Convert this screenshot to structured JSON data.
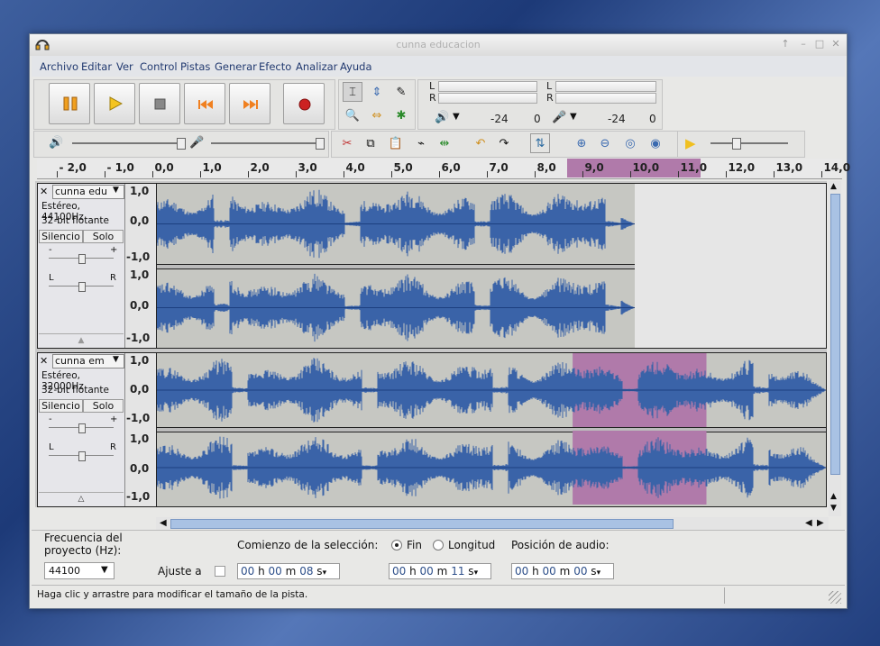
{
  "window": {
    "title": "cunna educacion"
  },
  "menu": [
    "Archivo",
    "Editar",
    "Ver",
    "Control",
    "Pistas",
    "Generar",
    "Efecto",
    "Analizar",
    "Ayuda"
  ],
  "meters": {
    "L": "L",
    "R": "R",
    "minus24a": "-24",
    "zero_a": "0",
    "minus24b": "-24",
    "zero_b": "0"
  },
  "ruler": [
    "- 2,0",
    "- 1,0",
    "0,0",
    "1,0",
    "2,0",
    "3,0",
    "4,0",
    "5,0",
    "6,0",
    "7,0",
    "8,0",
    "9,0",
    "10,0",
    "11,0",
    "12,0",
    "13,0",
    "14,0"
  ],
  "selection_range": {
    "start_seconds": 8.7,
    "end_seconds": 11.5
  },
  "tracks": [
    {
      "name": "cunna edu",
      "info1": "Estéreo, 44100Hz",
      "info2": "32-bit flotante",
      "mute": "Silencio",
      "solo": "Solo",
      "gain_minus": "-",
      "gain_plus": "+",
      "pan_l": "L",
      "pan_r": "R",
      "scale": [
        "1,0",
        "0,0",
        "-1,0"
      ],
      "length_seconds": 10.0
    },
    {
      "name": "cunna em",
      "info1": "Estéreo, 32000Hz",
      "info2": "32-bit flotante",
      "mute": "Silencio",
      "solo": "Solo",
      "gain_minus": "-",
      "gain_plus": "+",
      "pan_l": "L",
      "pan_r": "R",
      "scale": [
        "1,0",
        "0,0",
        "-1,0"
      ],
      "length_seconds": 14.0
    }
  ],
  "bottom": {
    "rate_label": "Frecuencia del proyecto (Hz):",
    "rate_value": "44100",
    "snap_label": "Ajuste a",
    "selection_label": "Comienzo de la selección:",
    "fin_label": "Fin",
    "longitud_label": "Longitud",
    "audio_pos_label": "Posición de audio:",
    "start_time": {
      "h": "00",
      "m": "00",
      "s": "08"
    },
    "end_time": {
      "h": "00",
      "m": "00",
      "s": "11"
    },
    "audio_time": {
      "h": "00",
      "m": "00",
      "s": "00"
    },
    "h_unit": "h",
    "m_unit": "m",
    "s_unit": "s"
  },
  "status": "Haga clic y arrastre para modificar el tamaño de la pista.",
  "colors": {
    "wave": "#3a63a8",
    "selection": "#b07aaa",
    "accent_record": "#cc2222"
  }
}
